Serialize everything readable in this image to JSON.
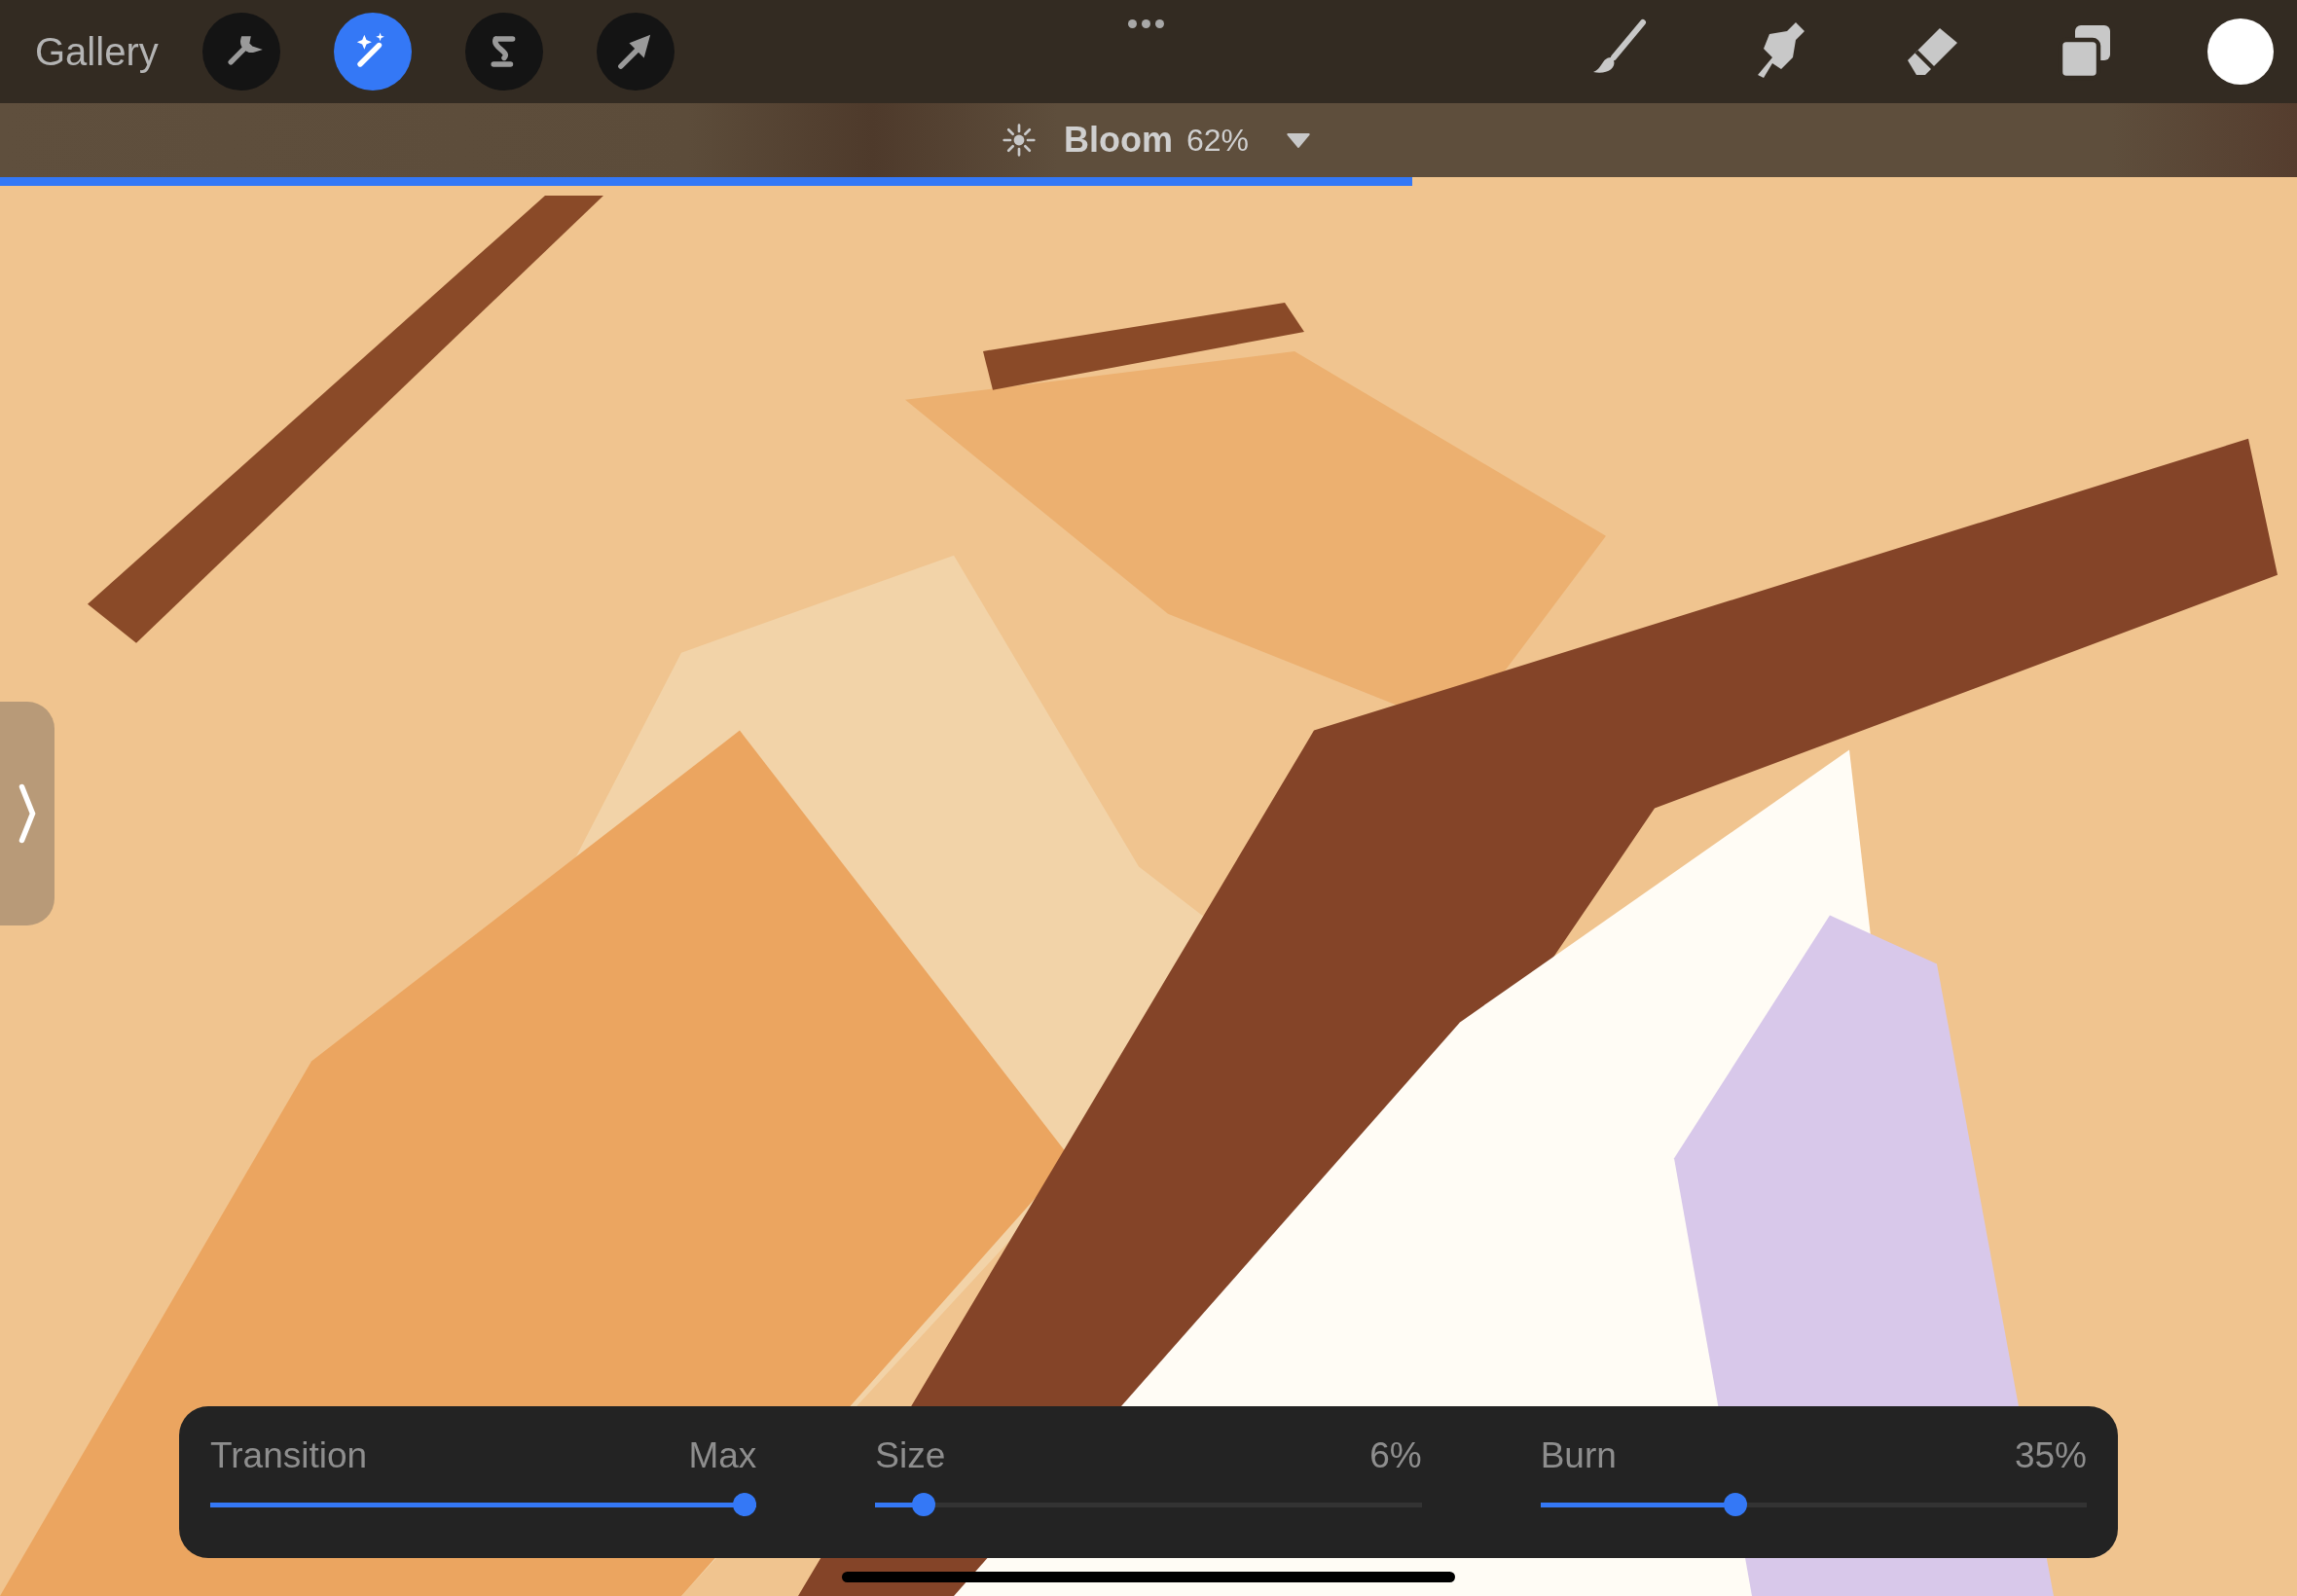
{
  "toolbar": {
    "gallery": "Gallery",
    "tools": [
      {
        "kind": "wrench",
        "selected": false
      },
      {
        "kind": "wand",
        "selected": true
      },
      {
        "kind": "selection",
        "selected": false
      },
      {
        "kind": "transform",
        "selected": false
      }
    ],
    "paint_tools": [
      {
        "kind": "brush"
      },
      {
        "kind": "smudge"
      },
      {
        "kind": "eraser"
      },
      {
        "kind": "layers"
      }
    ],
    "color": "#ffffff"
  },
  "adjustment": {
    "name": "Bloom",
    "value": "62%",
    "level": 0.615
  },
  "sliders": [
    {
      "label": "Transition",
      "value": "Max",
      "level": 1.0
    },
    {
      "label": "Size",
      "value": "6%",
      "level": 0.07
    },
    {
      "label": "Burn",
      "value": "35%",
      "level": 0.35
    }
  ]
}
